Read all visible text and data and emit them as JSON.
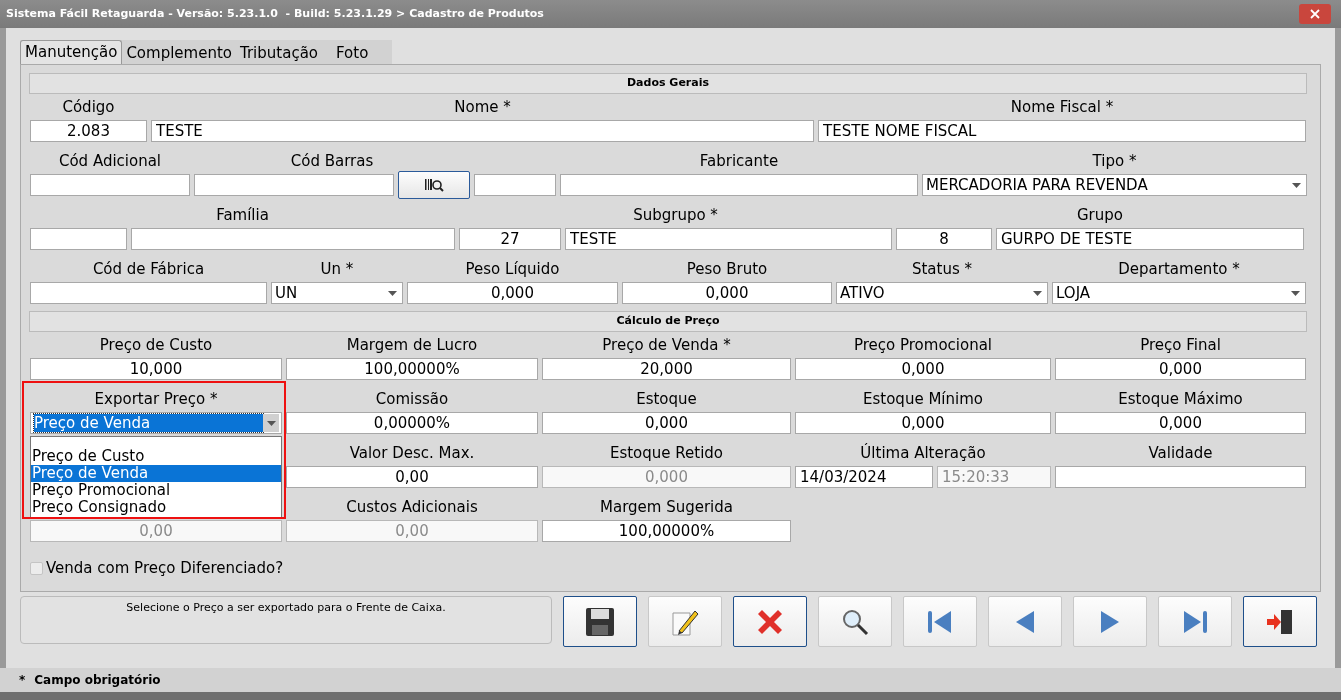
{
  "window": {
    "title": "Sistema Fácil Retaguarda - Versão: 5.23.1.0  - Build: 5.23.1.29 > Cadastro de Produtos"
  },
  "tabs": [
    {
      "label": "Manutenção",
      "selected": true
    },
    {
      "label": "Complemento",
      "selected": false
    },
    {
      "label": "Tributação",
      "selected": false
    },
    {
      "label": "Foto",
      "selected": false
    }
  ],
  "sections": [
    {
      "title": "Dados Gerais",
      "rows": [
        [
          {
            "label": "Código",
            "fields": [
              {
                "kind": "number",
                "value": "2.083",
                "disabled": false
              }
            ]
          },
          {
            "label": "Nome *",
            "fields": [
              {
                "kind": "text",
                "value": "TESTE",
                "disabled": false
              }
            ]
          },
          {
            "label": "Nome Fiscal *",
            "fields": [
              {
                "kind": "text",
                "value": "TESTE NOME FISCAL",
                "disabled": false
              }
            ]
          }
        ],
        [
          {
            "label": "Cód Adicional",
            "fields": [
              {
                "kind": "text",
                "disabled": false
              }
            ]
          },
          {
            "label": "Cód Barras",
            "fields": [
              {
                "kind": "text",
                "disabled": false
              },
              {
                "kind": "scan-button"
              }
            ]
          },
          {
            "fields": [
              {
                "kind": "text",
                "disabled": false
              }
            ]
          },
          {
            "label": "Fabricante",
            "fields": [
              {
                "kind": "text",
                "disabled": false
              }
            ]
          },
          {
            "label": "Tipo *",
            "fields": [
              {
                "kind": "select",
                "value": "MERCADORIA PARA REVENDA",
                "focused": false
              }
            ]
          }
        ],
        [
          {
            "label": "Família",
            "fields": [
              {
                "kind": "text",
                "disabled": false
              },
              {
                "kind": "text",
                "disabled": false
              }
            ]
          },
          {
            "label": "Subgrupo *",
            "fields": [
              {
                "kind": "number",
                "value": "27",
                "disabled": false
              },
              {
                "kind": "text",
                "value": "TESTE",
                "disabled": false
              }
            ]
          },
          {
            "label": "Grupo",
            "fields": [
              {
                "kind": "number",
                "value": "8",
                "disabled": false
              },
              {
                "kind": "text",
                "value": "GURPO DE TESTE",
                "disabled": false
              }
            ]
          }
        ],
        [
          {
            "label": "Cód de Fábrica",
            "fields": [
              {
                "kind": "text",
                "disabled": false
              }
            ]
          },
          {
            "label": "Un *",
            "fields": [
              {
                "kind": "select",
                "value": "UN",
                "focused": false
              }
            ]
          },
          {
            "label": "Peso Líquido",
            "fields": [
              {
                "kind": "number",
                "value": "0,000",
                "disabled": false
              }
            ]
          },
          {
            "label": "Peso Bruto",
            "fields": [
              {
                "kind": "number",
                "value": "0,000",
                "disabled": false
              }
            ]
          },
          {
            "label": "Status *",
            "fields": [
              {
                "kind": "select",
                "value": "ATIVO",
                "focused": false
              }
            ]
          },
          {
            "label": "Departamento *",
            "fields": [
              {
                "kind": "select",
                "value": "LOJA",
                "focused": false
              }
            ]
          }
        ]
      ]
    },
    {
      "title": "Cálculo de Preço",
      "rows": [
        [
          {
            "label": "Preço de Custo",
            "fields": [
              {
                "kind": "number",
                "value": "10,000",
                "disabled": false
              }
            ]
          },
          {
            "label": "Margem de Lucro",
            "fields": [
              {
                "kind": "number",
                "value": "100,00000%",
                "disabled": false
              }
            ]
          },
          {
            "label": "Preço de Venda *",
            "fields": [
              {
                "kind": "number",
                "value": "20,000",
                "disabled": false
              }
            ]
          },
          {
            "label": "Preço Promocional",
            "fields": [
              {
                "kind": "number",
                "value": "0,000",
                "disabled": false
              }
            ]
          },
          {
            "label": "Preço Final",
            "fields": [
              {
                "kind": "number",
                "value": "0,000",
                "disabled": false
              }
            ]
          }
        ],
        [
          {
            "label": "Exportar Preço *",
            "fields": [
              {
                "kind": "select",
                "value": "Preço de Venda",
                "focused": true
              }
            ],
            "dropdown": {
              "open": true,
              "options": [
                {
                  "label": "Preço de Custo",
                  "selected": false
                },
                {
                  "label": "Preço de Venda",
                  "selected": true
                },
                {
                  "label": "Preço Promocional",
                  "selected": false
                },
                {
                  "label": "Preço Consignado",
                  "selected": false
                }
              ]
            }
          },
          {
            "label": "Comissão",
            "fields": [
              {
                "kind": "number",
                "value": "0,00000%",
                "disabled": false
              }
            ]
          },
          {
            "label": "Estoque",
            "fields": [
              {
                "kind": "number",
                "value": "0,000",
                "disabled": false
              }
            ]
          },
          {
            "label": "Estoque Mínimo",
            "fields": [
              {
                "kind": "number",
                "value": "0,000",
                "disabled": false
              }
            ]
          },
          {
            "label": "Estoque Máximo",
            "fields": [
              {
                "kind": "number",
                "value": "0,000",
                "disabled": false
              }
            ]
          }
        ],
        [
          "",
          {
            "label": "Valor Desc. Max.",
            "fields": [
              {
                "kind": "number",
                "value": "0,00",
                "disabled": false
              }
            ]
          },
          {
            "label": "Estoque Retido",
            "fields": [
              {
                "kind": "number",
                "value": "0,000",
                "disabled": true
              }
            ]
          },
          {
            "label": "Última Alteração",
            "fields": [
              {
                "kind": "text",
                "value": "14/03/2024",
                "disabled": false
              },
              {
                "kind": "text",
                "value": "15:20:33",
                "disabled": true
              }
            ]
          },
          {
            "label": "Validade",
            "fields": [
              {
                "kind": "text",
                "disabled": false
              }
            ]
          }
        ],
        [
          {
            "fields": [
              {
                "kind": "number",
                "value": "0,00",
                "disabled": true
              }
            ]
          },
          {
            "label": "Custos Adicionais",
            "fields": [
              {
                "kind": "number",
                "value": "0,00",
                "disabled": true
              }
            ]
          },
          {
            "label": "Margem Sugerida",
            "fields": [
              {
                "kind": "number",
                "value": "100,00000%",
                "disabled": false
              }
            ]
          }
        ]
      ]
    }
  ],
  "checkbox": {
    "label": "Venda com Preço Diferenciado?",
    "checked": false
  },
  "hint": "Selecione o Preço a ser exportado para o Frente de Caixa.",
  "toolbar": [
    {
      "kind": "save",
      "focused": true
    },
    {
      "kind": "edit",
      "focused": false
    },
    {
      "kind": "delete",
      "focused": true
    },
    {
      "kind": "search",
      "focused": false
    },
    {
      "kind": "first",
      "focused": false
    },
    {
      "kind": "previous",
      "focused": false
    },
    {
      "kind": "next",
      "focused": false
    },
    {
      "kind": "last",
      "focused": false
    },
    {
      "kind": "exit",
      "focused": true
    }
  ],
  "footer": {
    "mark": "*",
    "text": "Campo obrigatório"
  }
}
